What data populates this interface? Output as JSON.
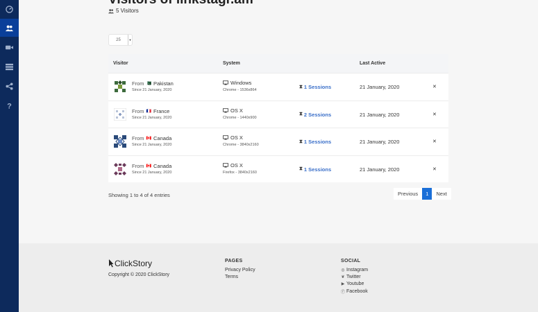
{
  "header": {
    "title": "Visitors of linkstagr.am",
    "visitors_count": "5 Visitors"
  },
  "sidebar": {
    "items": [
      {
        "icon": "dashboard-icon"
      },
      {
        "icon": "users-icon",
        "active": true
      },
      {
        "icon": "video-icon"
      },
      {
        "icon": "list-icon"
      },
      {
        "icon": "share-icon"
      },
      {
        "icon": "help-icon"
      }
    ]
  },
  "table": {
    "page_length": "25",
    "headers": {
      "visitor": "Visitor",
      "system": "System",
      "sessions": "",
      "last_active": "Last Active"
    },
    "rows": [
      {
        "from_label": "From",
        "flag": "🇵🇰",
        "country": "Pakistan",
        "since": "Since 21 January, 2020",
        "os": "Windows",
        "browser": "Chrome - 1536x864",
        "sessions": "1 Sessions",
        "last_active": "21 January, 2020"
      },
      {
        "from_label": "From",
        "flag": "🇫🇷",
        "country": "France",
        "since": "Since 21 January, 2020",
        "os": "OS X",
        "browser": "Chrome - 1440x900",
        "sessions": "2 Sessions",
        "last_active": "21 January, 2020"
      },
      {
        "from_label": "From",
        "flag": "🇨🇦",
        "country": "Canada",
        "since": "Since 21 January, 2020",
        "os": "OS X",
        "browser": "Chrome - 3840x2160",
        "sessions": "1 Sessions",
        "last_active": "21 January, 2020"
      },
      {
        "from_label": "From",
        "flag": "🇨🇦",
        "country": "Canada",
        "since": "Since 21 January, 2020",
        "os": "OS X",
        "browser": "Firefox - 3840x2160",
        "sessions": "1 Sessions",
        "last_active": "21 January, 2020"
      }
    ],
    "info": "Showing 1 to 4 of 4 entries",
    "pagination": {
      "previous": "Previous",
      "current": "1",
      "next": "Next"
    }
  },
  "footer": {
    "brand": "ClickStory",
    "copyright": "Copyright © 2020 ClickStory",
    "pages": {
      "heading": "PAGES",
      "links": [
        "Privacy Policy",
        "Terms"
      ]
    },
    "social": {
      "heading": "SOCIAL",
      "links": [
        {
          "label": "Instagram",
          "icon": "instagram-icon"
        },
        {
          "label": "Twitter",
          "icon": "twitter-icon"
        },
        {
          "label": "Youtube",
          "icon": "youtube-icon"
        },
        {
          "label": "Facebook",
          "icon": "facebook-icon"
        }
      ]
    }
  },
  "colors": {
    "sidebar": "#0d2a5c",
    "sidebar_active": "#0a3f9a",
    "accent": "#1a6fd8",
    "sessions": "#3a6fc9"
  }
}
